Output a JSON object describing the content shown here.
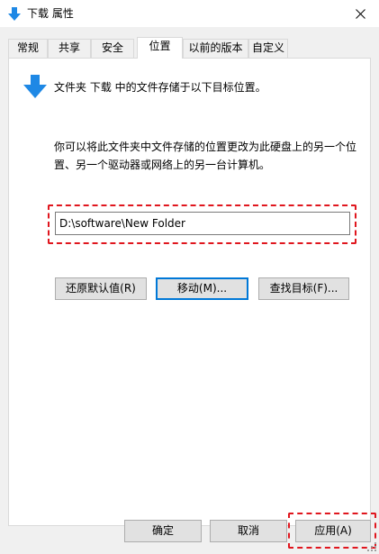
{
  "window": {
    "title": "下载 属性",
    "icon": "download-arrow-icon",
    "close_icon": "close-icon"
  },
  "tabs": [
    {
      "label": "常规",
      "active": false
    },
    {
      "label": "共享",
      "active": false
    },
    {
      "label": "安全",
      "active": false
    },
    {
      "label": "位置",
      "active": true
    },
    {
      "label": "以前的版本",
      "active": false
    },
    {
      "label": "自定义",
      "active": false
    }
  ],
  "location": {
    "info": "文件夹 下载 中的文件存储于以下目标位置。",
    "description": "你可以将此文件夹中文件存储的位置更改为此硬盘上的另一个位置、另一个驱动器或网络上的另一台计算机。",
    "path": "D:\\software\\New Folder",
    "restore_label": "还原默认值(R)",
    "move_label": "移动(M)...",
    "find_label": "查找目标(F)..."
  },
  "footer": {
    "ok_label": "确定",
    "cancel_label": "取消",
    "apply_label": "应用(A)"
  },
  "colors": {
    "accent": "#0078d7",
    "highlight": "#e0161e",
    "icon_blue": "#1e88e5"
  }
}
